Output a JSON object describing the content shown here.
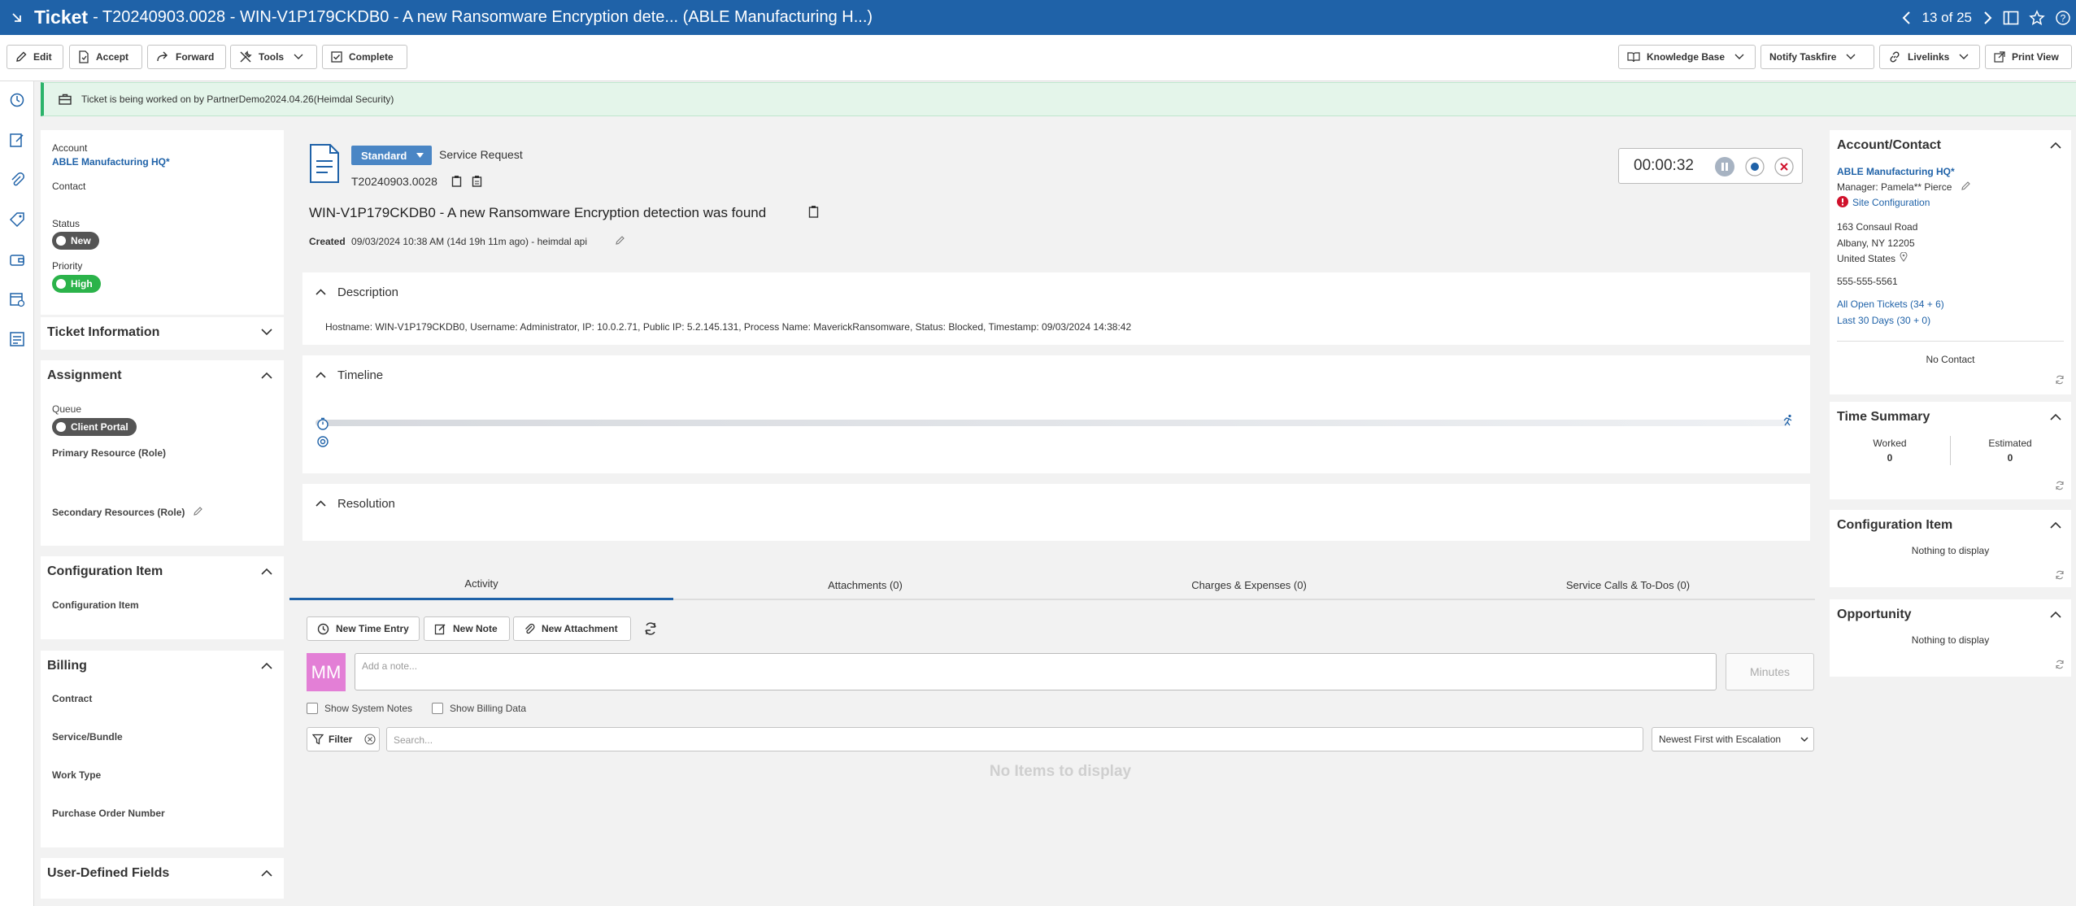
{
  "titlebar": {
    "title": "Ticket",
    "subtitle": "- T20240903.0028 - WIN-V1P179CKDB0 - A new Ransomware Encryption dete... (ABLE Manufacturing H...)",
    "pager": "13 of 25"
  },
  "toolbar": {
    "edit": "Edit",
    "accept": "Accept",
    "forward": "Forward",
    "tools": "Tools",
    "complete": "Complete",
    "knowledge_base": "Knowledge Base",
    "notify_taskfire": "Notify Taskfire",
    "livelinks": "Livelinks",
    "print_view": "Print View"
  },
  "notice": "Ticket is being worked on by PartnerDemo2024.04.26(Heimdal Security)",
  "left": {
    "account_label": "Account",
    "account_value": "ABLE Manufacturing HQ*",
    "contact_label": "Contact",
    "status_label": "Status",
    "status_value": "New",
    "priority_label": "Priority",
    "priority_value": "High",
    "ticket_info": "Ticket Information",
    "assignment": "Assignment",
    "queue_label": "Queue",
    "queue_value": "Client Portal",
    "primary_resource": "Primary Resource (Role)",
    "secondary_resources": "Secondary Resources (Role)",
    "config_item_header": "Configuration Item",
    "config_item_label": "Configuration Item",
    "billing": "Billing",
    "contract": "Contract",
    "service_bundle": "Service/Bundle",
    "work_type": "Work Type",
    "po_number": "Purchase Order Number",
    "udf": "User-Defined Fields"
  },
  "ticket": {
    "type_button": "Standard",
    "category": "Service Request",
    "number": "T20240903.0028",
    "title": "WIN-V1P179CKDB0 - A new Ransomware Encryption detection was found",
    "created_label": "Created",
    "created_value": "09/03/2024 10:38 AM (14d 19h 11m ago) - heimdal api",
    "timer": "00:00:32",
    "description_header": "Description",
    "description_text": "Hostname: WIN-V1P179CKDB0, Username: Administrator, IP: 10.0.2.71, Public IP: 5.2.145.131, Process Name: MaverickRansomware, Status: Blocked, Timestamp: 09/03/2024 14:38:42",
    "timeline_header": "Timeline",
    "resolution_header": "Resolution"
  },
  "tabs": [
    {
      "label": "Activity"
    },
    {
      "label": "Attachments (0)"
    },
    {
      "label": "Charges & Expenses (0)"
    },
    {
      "label": "Service Calls & To-Dos (0)"
    }
  ],
  "activity": {
    "new_time_entry": "New Time Entry",
    "new_note": "New Note",
    "new_attachment": "New Attachment",
    "avatar_initials": "MM",
    "note_placeholder": "Add a note...",
    "minutes": "Minutes",
    "show_system_notes": "Show System Notes",
    "show_billing_data": "Show Billing Data",
    "filter": "Filter",
    "search_placeholder": "Search...",
    "sort_value": "Newest First with Escalation",
    "empty": "No Items to display"
  },
  "right": {
    "account_contact_header": "Account/Contact",
    "account_name": "ABLE Manufacturing HQ*",
    "manager": "Manager: Pamela** Pierce",
    "site_config": "Site Configuration",
    "addr1": "163 Consaul Road",
    "addr2": "Albany, NY 12205",
    "addr3": "United States",
    "phone": "555-555-5561",
    "all_open_prefix": "All Open Tickets",
    "all_open_count": "(34 + 6)",
    "last30_prefix": "Last 30 Days",
    "last30_count": "(30 + 0)",
    "no_contact": "No Contact",
    "time_summary_header": "Time Summary",
    "worked_label": "Worked",
    "worked_value": "0",
    "estimated_label": "Estimated",
    "estimated_value": "0",
    "config_header": "Configuration Item",
    "config_empty": "Nothing to display",
    "opportunity_header": "Opportunity",
    "opportunity_empty": "Nothing to display"
  },
  "colors": {
    "brand": "#1f62a8",
    "status_new": "#555555",
    "priority_high": "#2bb34a",
    "notice_bg": "#e4f5ea",
    "avatar": "#e37fd6",
    "alert": "#d0112b"
  }
}
